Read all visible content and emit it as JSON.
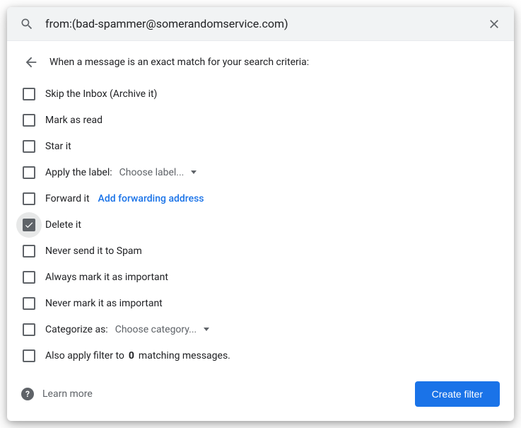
{
  "search": {
    "query": "from:(bad-spammer@somerandomservice.com)"
  },
  "header": {
    "instruction": "When a message is an exact match for your search criteria:"
  },
  "options": {
    "skip_inbox": "Skip the Inbox (Archive it)",
    "mark_read": "Mark as read",
    "star": "Star it",
    "apply_label": "Apply the label:",
    "choose_label": "Choose label...",
    "forward": "Forward it",
    "add_forwarding": "Add forwarding address",
    "delete": "Delete it",
    "never_spam": "Never send it to Spam",
    "always_important": "Always mark it as important",
    "never_important": "Never mark it as important",
    "categorize": "Categorize as:",
    "choose_category": "Choose category...",
    "also_apply_pre": "Also apply filter to ",
    "also_apply_count": "0",
    "also_apply_post": " matching messages."
  },
  "footer": {
    "learn_more": "Learn more",
    "create_filter": "Create filter"
  }
}
